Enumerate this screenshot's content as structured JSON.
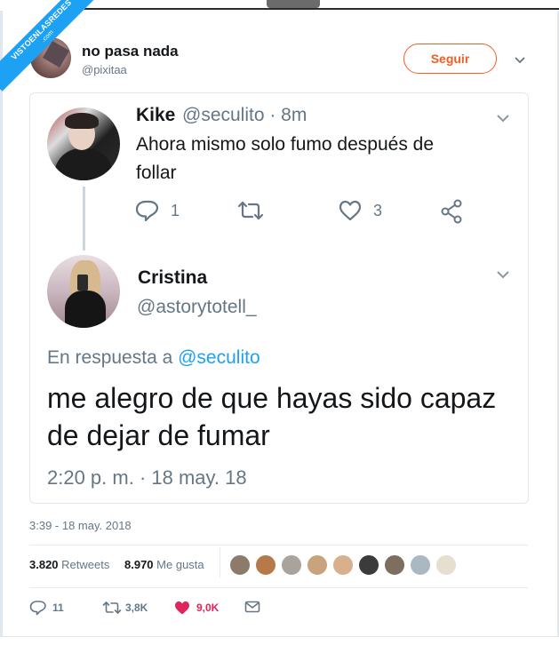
{
  "watermark": {
    "line1": "VISTOENLASREDES",
    "line2": ".com"
  },
  "author": {
    "name": "no pasa nada",
    "handle": "@pixitaa"
  },
  "follow_button": {
    "label": "Seguir"
  },
  "quoted_thread": {
    "parent": {
      "name": "Kike",
      "meta": "@seculito · 8m",
      "text": "Ahora mismo solo fumo después de follar",
      "reply_count": "1",
      "like_count": "3"
    },
    "reply": {
      "name": "Cristina",
      "handle": "@astorytotell_",
      "reply_prefix": "En respuesta a",
      "reply_mention": "@seculito",
      "text": "me alegro de que hayas sido capaz de dejar de fumar",
      "timestamp": "2:20 p. m. · 18 may. 18"
    }
  },
  "tweet_timestamp": "3:39 - 18 may. 2018",
  "stats": {
    "retweets_count": "3.820",
    "retweets_label": "Retweets",
    "likes_count": "8.970",
    "likes_label": "Me gusta"
  },
  "bottom_actions": {
    "replies": "11",
    "retweets": "3,8K",
    "likes": "9,0K"
  },
  "colors": {
    "accent": "#1da1f2",
    "follow": "#f45d22",
    "like": "#e0245e",
    "muted": "#657786"
  },
  "icons": [
    "reply-icon",
    "retweet-icon",
    "heart-icon",
    "share-icon",
    "mail-icon",
    "chevron-down-icon"
  ]
}
